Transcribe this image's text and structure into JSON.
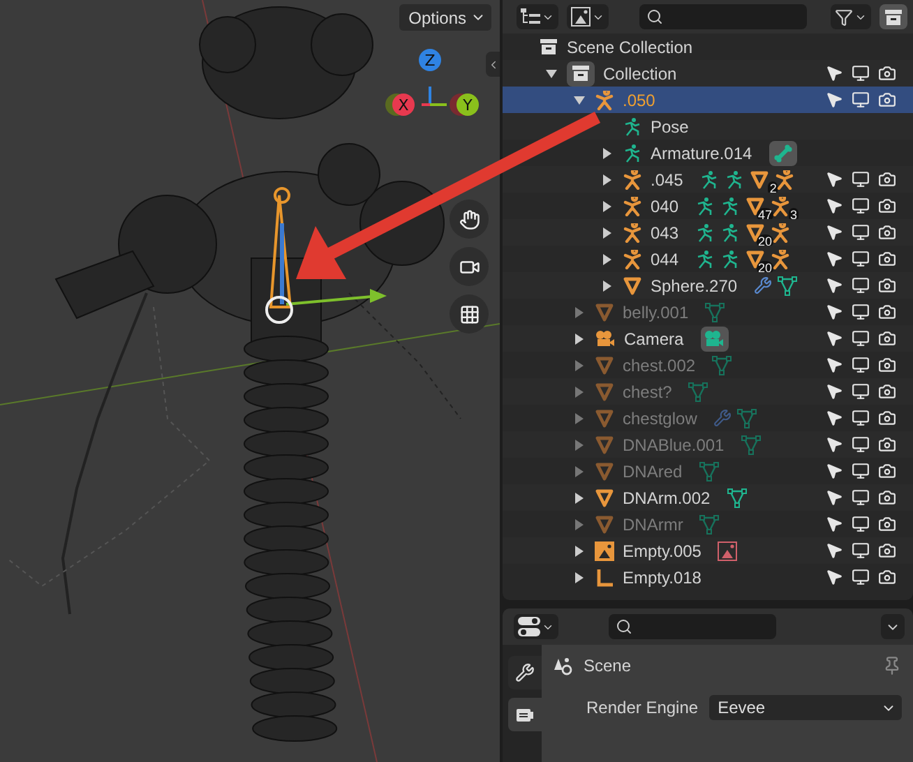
{
  "viewport": {
    "options_button": "Options",
    "gizmo": [
      {
        "kind": "z",
        "label": "Z"
      },
      {
        "kind": "x",
        "label": "X"
      },
      {
        "kind": "y",
        "label": "Y"
      }
    ]
  },
  "outliner": {
    "rows": [
      {
        "name": "Scene Collection",
        "kind": "collection",
        "selected": false,
        "restrict_toggles": false,
        "children": [
          {
            "name": "Collection",
            "kind": "collection-boxed",
            "expanded": true,
            "selected": false,
            "restrict_toggles": true,
            "children": [
              {
                "name": ".050",
                "kind": "armature",
                "expanded": true,
                "selected": true,
                "dim": false,
                "restrict_toggles": true,
                "children": [
                  {
                    "name": "Pose",
                    "kind": "pose",
                    "selected": false,
                    "dim": false,
                    "restrict_toggles": false
                  },
                  {
                    "name": "Armature.014",
                    "kind": "pose",
                    "expanded": false,
                    "selected": false,
                    "dim": false,
                    "restrict_toggles": false,
                    "extras": [
                      {
                        "kind": "bone-chip"
                      }
                    ]
                  },
                  {
                    "name": ".045",
                    "kind": "armature",
                    "expanded": false,
                    "selected": false,
                    "dim": false,
                    "restrict_toggles": true,
                    "extras": [
                      {
                        "kind": "pose"
                      },
                      {
                        "kind": "armature-data"
                      },
                      {
                        "kind": "mesh",
                        "badge": "2"
                      },
                      {
                        "kind": "armature"
                      }
                    ]
                  },
                  {
                    "name": "040",
                    "kind": "armature",
                    "expanded": false,
                    "selected": false,
                    "dim": false,
                    "restrict_toggles": true,
                    "extras": [
                      {
                        "kind": "pose"
                      },
                      {
                        "kind": "armature-data"
                      },
                      {
                        "kind": "mesh",
                        "badge": "47"
                      },
                      {
                        "kind": "armature",
                        "badge": "3"
                      }
                    ]
                  },
                  {
                    "name": "043",
                    "kind": "armature",
                    "expanded": false,
                    "selected": false,
                    "dim": false,
                    "restrict_toggles": true,
                    "extras": [
                      {
                        "kind": "pose"
                      },
                      {
                        "kind": "armature-data"
                      },
                      {
                        "kind": "mesh",
                        "badge": "20"
                      },
                      {
                        "kind": "armature"
                      }
                    ]
                  },
                  {
                    "name": "044",
                    "kind": "armature",
                    "expanded": false,
                    "selected": false,
                    "dim": false,
                    "restrict_toggles": true,
                    "extras": [
                      {
                        "kind": "pose"
                      },
                      {
                        "kind": "armature-data"
                      },
                      {
                        "kind": "mesh",
                        "badge": "20"
                      },
                      {
                        "kind": "armature"
                      }
                    ]
                  },
                  {
                    "name": "Sphere.270",
                    "kind": "mesh",
                    "expanded": false,
                    "selected": false,
                    "dim": false,
                    "restrict_toggles": true,
                    "extras": [
                      {
                        "kind": "wrench"
                      },
                      {
                        "kind": "mesh-data"
                      }
                    ]
                  }
                ]
              },
              {
                "name": "belly.001",
                "kind": "mesh",
                "expanded": false,
                "selected": false,
                "dim": true,
                "restrict_toggles": true,
                "extras": [
                  {
                    "kind": "mesh-data"
                  }
                ]
              },
              {
                "name": "Camera",
                "kind": "camera",
                "expanded": false,
                "selected": false,
                "dim": false,
                "restrict_toggles": true,
                "extras": [
                  {
                    "kind": "camera-chip"
                  }
                ]
              },
              {
                "name": "chest.002",
                "kind": "mesh",
                "expanded": false,
                "selected": false,
                "dim": true,
                "restrict_toggles": true,
                "extras": [
                  {
                    "kind": "mesh-data"
                  }
                ]
              },
              {
                "name": "chest?",
                "kind": "mesh",
                "expanded": false,
                "selected": false,
                "dim": true,
                "restrict_toggles": true,
                "extras": [
                  {
                    "kind": "mesh-data"
                  }
                ]
              },
              {
                "name": "chestglow",
                "kind": "mesh",
                "expanded": false,
                "selected": false,
                "dim": true,
                "restrict_toggles": true,
                "extras": [
                  {
                    "kind": "wrench"
                  },
                  {
                    "kind": "mesh-data"
                  }
                ]
              },
              {
                "name": "DNABlue.001",
                "kind": "mesh",
                "expanded": false,
                "selected": false,
                "dim": true,
                "restrict_toggles": true,
                "extras": [
                  {
                    "kind": "mesh-data"
                  }
                ]
              },
              {
                "name": "DNAred",
                "kind": "mesh",
                "expanded": false,
                "selected": false,
                "dim": true,
                "restrict_toggles": true,
                "extras": [
                  {
                    "kind": "mesh-data"
                  }
                ]
              },
              {
                "name": "DNArm.002",
                "kind": "mesh",
                "expanded": false,
                "selected": false,
                "dim": false,
                "restrict_toggles": true,
                "extras": [
                  {
                    "kind": "mesh-data"
                  }
                ]
              },
              {
                "name": "DNArmr",
                "kind": "mesh",
                "expanded": false,
                "selected": false,
                "dim": true,
                "restrict_toggles": true,
                "extras": [
                  {
                    "kind": "mesh-data"
                  }
                ]
              },
              {
                "name": "Empty.005",
                "kind": "empty-image",
                "expanded": false,
                "selected": false,
                "dim": false,
                "restrict_toggles": true,
                "extras": [
                  {
                    "kind": "image"
                  }
                ]
              },
              {
                "name": "Empty.018",
                "kind": "empty",
                "expanded": false,
                "selected": false,
                "dim": false,
                "restrict_toggles": true
              }
            ]
          }
        ]
      }
    ]
  },
  "properties": {
    "tabs": [
      {
        "kind": "tool",
        "selected": false
      },
      {
        "kind": "scene",
        "selected": true
      }
    ],
    "title": "Scene",
    "fields": [
      {
        "label": "Render Engine",
        "value": "Eevee"
      }
    ]
  }
}
